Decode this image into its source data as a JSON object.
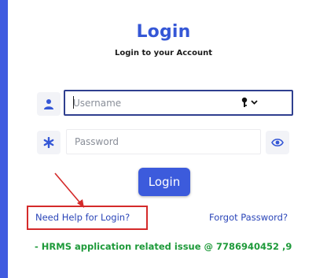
{
  "login": {
    "title": "Login",
    "subtitle": "Login to your Account",
    "username_placeholder": "Username",
    "password_placeholder": "Password",
    "submit_label": "Login",
    "help_link": "Need Help for Login?",
    "forgot_link": "Forgot Password?"
  },
  "announcement": {
    "text": "- HRMS application related issue @ 7786940452 ,9"
  },
  "icons": {
    "user": "user-icon",
    "password": "asterisk-icon",
    "key": "key-icon",
    "eye": "eye-icon",
    "arrow": "arrow-annotation"
  },
  "colors": {
    "accent": "#3c5bdc",
    "background_panel": "#3f5be0",
    "highlight_border": "#d42a2a",
    "announcement": "#1e9a3a"
  }
}
